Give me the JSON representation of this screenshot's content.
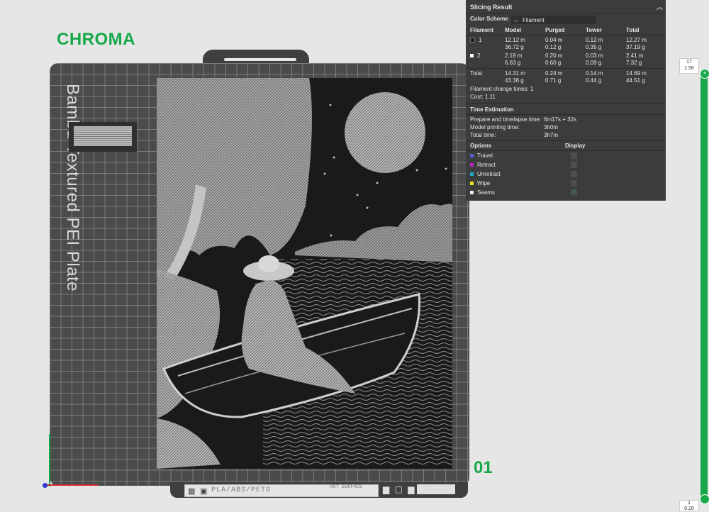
{
  "brand": "CHROMA",
  "plate": {
    "label": "Bambu Textured PEI Plate",
    "number": "01",
    "footer": {
      "grid_glyph": "▦ ▣",
      "material": "PLA/ABS/PETG",
      "warning": "HOT SURFACE",
      "icons": "▆ ▢ ▆"
    }
  },
  "slicing_result": {
    "title": "Slicing Result",
    "collapse_icon": "︽",
    "color_scheme_label": "Color Scheme",
    "color_scheme_value": "Filament",
    "headers": [
      "Filament",
      "Model",
      "Purged",
      "Tower",
      "Total"
    ],
    "filaments": [
      {
        "id": "1",
        "color": "#1a1a1a",
        "model": [
          "12.12 m",
          "36.72 g"
        ],
        "purged": [
          "0.04 m",
          "0.12 g"
        ],
        "tower": [
          "0.12 m",
          "0.35 g"
        ],
        "total": [
          "12.27 m",
          "37.19 g"
        ]
      },
      {
        "id": "2",
        "color": "#ffffff",
        "model": [
          "2.19 m",
          "6.63 g"
        ],
        "purged": [
          "0.20 m",
          "0.60 g"
        ],
        "tower": [
          "0.03 m",
          "0.09 g"
        ],
        "total": [
          "2.41 m",
          "7.32 g"
        ]
      }
    ],
    "total": {
      "label": "Total",
      "model": [
        "14.31 m",
        "43.36 g"
      ],
      "purged": [
        "0.24 m",
        "0.71 g"
      ],
      "tower": [
        "0.14 m",
        "0.44 g"
      ],
      "total": [
        "14.69 m",
        "44.51 g"
      ]
    },
    "filament_change_times": "Filament change times:  1",
    "cost": "Cost:  1.11",
    "time_estimation_title": "Time Estimation",
    "time_rows": [
      {
        "label": "Prepare and timelapse time:",
        "value": "6m17s + 32s"
      },
      {
        "label": "Model printing time:",
        "value": "3h0m"
      },
      {
        "label": "Total time:",
        "value": "3h7m"
      }
    ],
    "options_header": "Options",
    "display_header": "Display",
    "options": [
      {
        "label": "Travel",
        "color": "#5a5fd8",
        "checked": false
      },
      {
        "label": "Retract",
        "color": "#c020c8",
        "checked": false
      },
      {
        "label": "Unretract",
        "color": "#20a8c8",
        "checked": false
      },
      {
        "label": "Wipe",
        "color": "#f0e020",
        "checked": false
      },
      {
        "label": "Seams",
        "color": "#f0f0f0",
        "checked": true
      }
    ]
  },
  "layer_slider": {
    "top_layer": "17",
    "top_height": "1.56",
    "bottom_layer": "1",
    "bottom_height": "0.20",
    "add_icon": "+"
  }
}
